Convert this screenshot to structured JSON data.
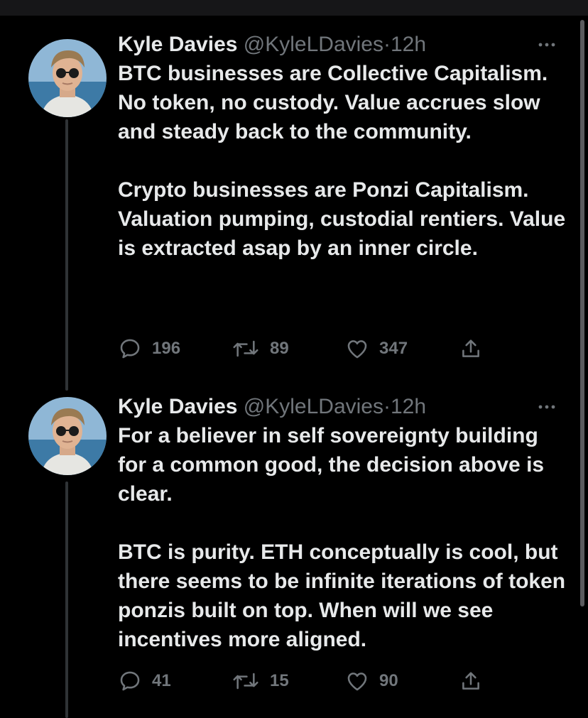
{
  "tweets": [
    {
      "author_name": "Kyle Davies",
      "handle": "@KyleLDavies",
      "separator": "·",
      "time": "12h",
      "paragraphs": [
        "BTC businesses are Collective Capitalism. No token, no custody. Value accrues slow and steady back to the community.",
        "Crypto businesses are Ponzi Capitalism. Valuation pumping, custodial rentiers. Value is extracted asap by an inner circle."
      ],
      "replies": "196",
      "retweets": "89",
      "likes": "347"
    },
    {
      "author_name": "Kyle Davies",
      "handle": "@KyleLDavies",
      "separator": "·",
      "time": "12h",
      "paragraphs": [
        "For a believer in self sovereignty building for a common good, the decision above is clear.",
        "BTC is purity. ETH conceptually is cool, but there seems to be infinite iterations of token ponzis built on top. When will we see incentives more aligned."
      ],
      "replies": "41",
      "retweets": "15",
      "likes": "90"
    }
  ],
  "icons": {
    "reply": "speech-bubble-icon",
    "retweet": "retweet-arrows-icon",
    "like": "heart-icon",
    "share": "share-upload-icon",
    "more": "more-dots-icon"
  },
  "colors": {
    "background": "#000000",
    "text": "#e7e9ea",
    "secondary": "#71767b",
    "thread_line": "#2f3336"
  }
}
